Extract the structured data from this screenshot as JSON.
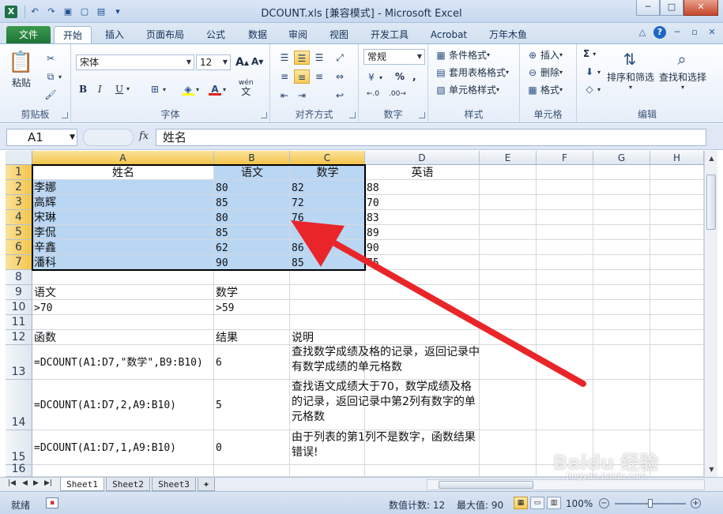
{
  "app": {
    "title": "DCOUNT.xls  [兼容模式]  -  Microsoft Excel",
    "logo": "X"
  },
  "ribbon_tabs": [
    "文件",
    "开始",
    "插入",
    "页面布局",
    "公式",
    "数据",
    "审阅",
    "视图",
    "开发工具",
    "Acrobat",
    "万年木鱼"
  ],
  "ribbon": {
    "clipboard": {
      "paste": "粘贴",
      "label": "剪贴板"
    },
    "font": {
      "name": "宋体",
      "size": "12",
      "bold": "B",
      "italic": "I",
      "underline": "U",
      "label": "字体",
      "wen": "wén",
      "wen2": "文"
    },
    "alignment": {
      "label": "对齐方式"
    },
    "number": {
      "format": "常规",
      "label": "数字",
      "pct": "%",
      "comma": ","
    },
    "styles": {
      "cond": "条件格式",
      "table": "套用表格格式",
      "cell": "单元格样式",
      "label": "样式"
    },
    "cells": {
      "insert": "插入",
      "delete": "删除",
      "format": "格式",
      "label": "单元格"
    },
    "editing": {
      "sort": "排序和筛选",
      "find": "查找和选择",
      "label": "编辑",
      "sigma": "Σ"
    }
  },
  "formula_bar": {
    "name_box": "A1",
    "fx": "fx",
    "content": "姓名"
  },
  "columns": [
    "A",
    "B",
    "C",
    "D",
    "E",
    "F",
    "G",
    "H"
  ],
  "rows": [
    "1",
    "2",
    "3",
    "4",
    "5",
    "6",
    "7",
    "8",
    "9",
    "10",
    "11",
    "12",
    "13",
    "14",
    "15",
    "16"
  ],
  "cells": {
    "r1": [
      "姓名",
      "语文",
      "数学",
      "英语"
    ],
    "data": [
      [
        "李娜",
        "80",
        "82",
        "88"
      ],
      [
        "高辉",
        "85",
        "72",
        "70"
      ],
      [
        "宋琳",
        "80",
        "76",
        "83"
      ],
      [
        "李侃",
        "85",
        "",
        "89"
      ],
      [
        "辛鑫",
        "62",
        "86",
        "90"
      ],
      [
        "潘科",
        "90",
        "85",
        "75"
      ]
    ],
    "r9": [
      "语文",
      "数学"
    ],
    "r10": [
      ">70",
      ">59"
    ],
    "r12": [
      "函数",
      "结果",
      "说明"
    ],
    "r13": [
      "=DCOUNT(A1:D7,\"数学\",B9:B10)",
      "6",
      "查找数学成绩及格的记录，返回记录中有数学成绩的单元格数"
    ],
    "r14": [
      "=DCOUNT(A1:D7,2,A9:B10)",
      "5",
      "查找语文成绩大于70，数学成绩及格的记录，返回记录中第2列有数字的单元格数"
    ],
    "r15": [
      "=DCOUNT(A1:D7,1,A9:B10)",
      "0",
      "由于列表的第1列不是数字，函数结果错误!"
    ]
  },
  "sheets": [
    "Sheet1",
    "Sheet2",
    "Sheet3"
  ],
  "status": {
    "mode": "就绪",
    "count": "数值计数: 12",
    "max": "最大值: 90",
    "zoom": "100%"
  },
  "watermark": {
    "text": "Baidu 经验",
    "url": "jingyan.baidu.com"
  },
  "colors": {
    "accent": "#f3c44b",
    "selection": "#9bc4ee",
    "arrow": "#e8262a",
    "file_tab": "#1f7337"
  }
}
